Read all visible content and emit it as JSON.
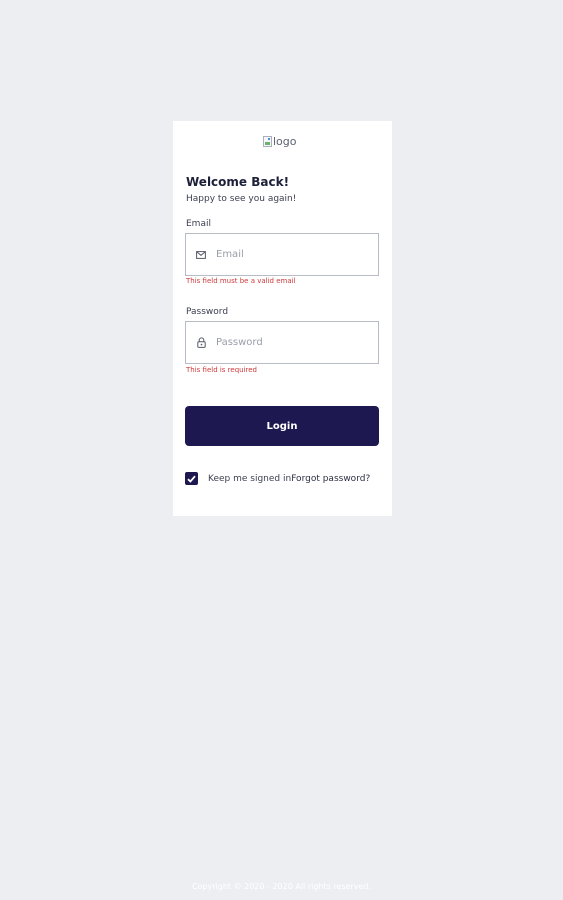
{
  "logo": {
    "alt_text": "logo"
  },
  "header": {
    "title": "Welcome Back!",
    "subtitle": "Happy to see you again!"
  },
  "email": {
    "label": "Email",
    "placeholder": "Email",
    "value": "",
    "icon": "envelope-icon",
    "error": "This field must be a valid email"
  },
  "password": {
    "label": "Password",
    "placeholder": "Password",
    "value": "",
    "icon": "lock-icon",
    "error": "This field is required"
  },
  "actions": {
    "login_label": "Login",
    "remember_label": "Keep me signed in",
    "remember_checked": true,
    "forgot_label": "Forgot password?"
  },
  "footer": {
    "copyright": "Copyright © 2020 - 2020 All rights reserved."
  },
  "colors": {
    "background": "#eceef2",
    "card": "#ffffff",
    "primary": "#1e1850",
    "error": "#d0393a"
  }
}
